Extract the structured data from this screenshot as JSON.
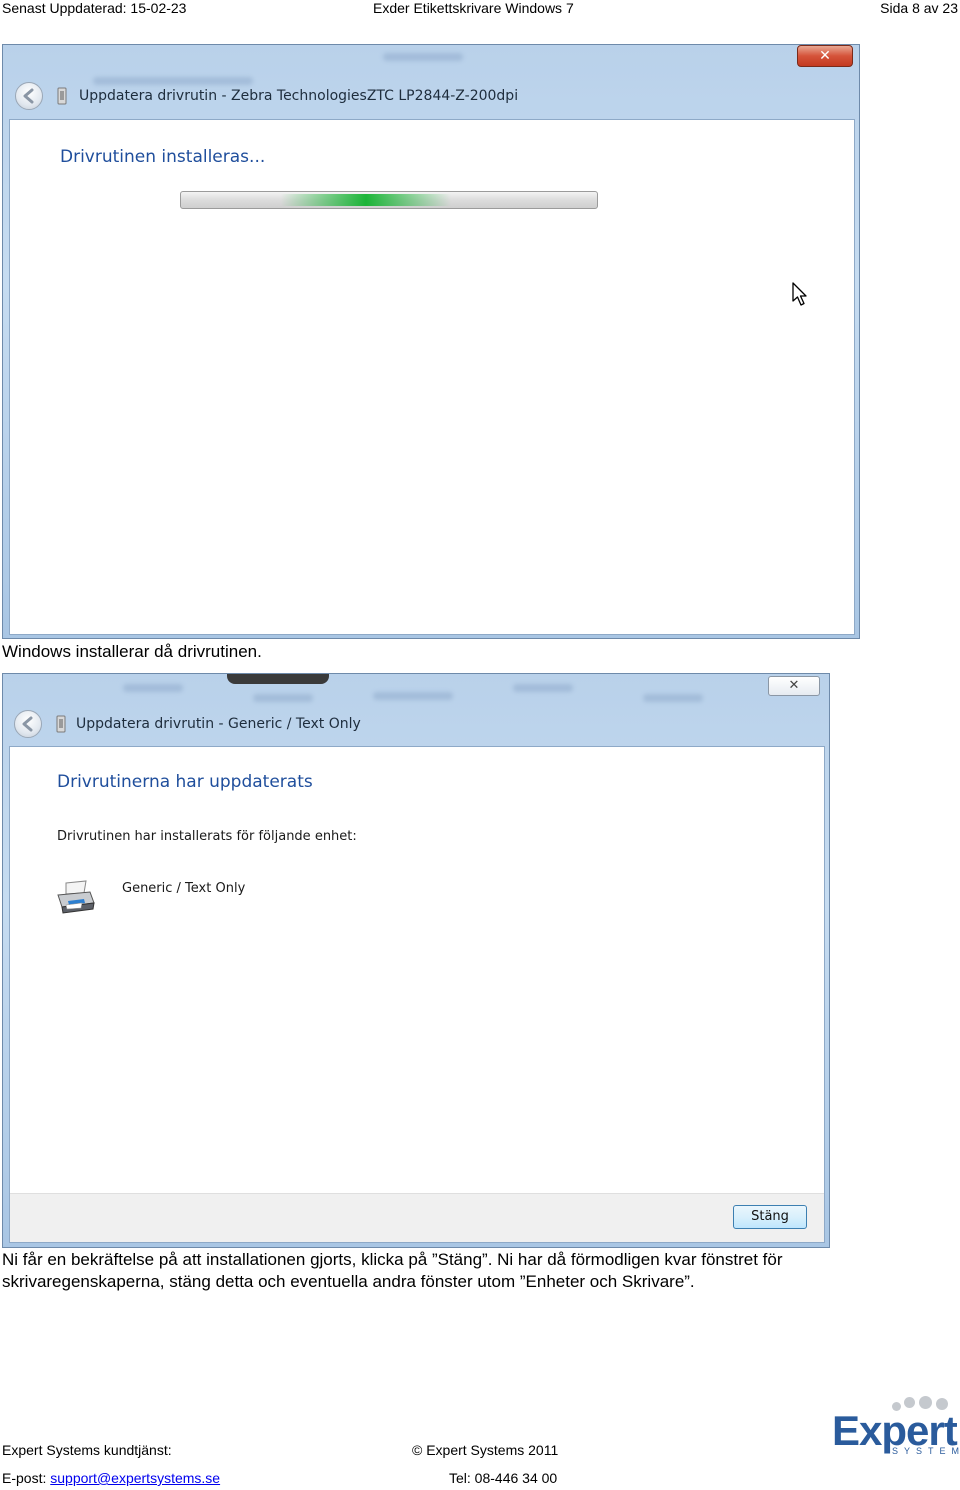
{
  "header": {
    "left": "Senast Uppdaterad: 15-02-23",
    "center": "Exder Etikettskrivare Windows 7",
    "right": "Sida 8 av 23"
  },
  "dialog1": {
    "title": "Uppdatera drivrutin - Zebra TechnologiesZTC LP2844-Z-200dpi",
    "heading": "Drivrutinen installeras...",
    "close_glyph": "✕"
  },
  "caption1": "Windows installerar då drivrutinen.",
  "dialog2": {
    "title": "Uppdatera drivrutin - Generic / Text Only",
    "heading": "Drivrutinerna har uppdaterats",
    "body": "Drivrutinen har installerats för följande enhet:",
    "device": "Generic / Text Only",
    "close_button": "Stäng",
    "close_glyph": "✕"
  },
  "caption2": {
    "line1": "Ni får en bekräftelse på att installationen gjorts, klicka på ”Stäng”. Ni har då förmodligen kvar fönstret för",
    "line2": "skrivaregenskaperna, stäng detta och eventuella andra fönster utom ”Enheter och Skrivare”."
  },
  "footer": {
    "support_label": "Expert Systems kundtjänst:",
    "copyright": "© Expert Systems 2011",
    "email_label": "E-post:",
    "email": "support@expertsystems.se",
    "phone": "Tel: 08-446 34 00",
    "logo_word": "Expert",
    "logo_sub": "SYSTEMS"
  }
}
